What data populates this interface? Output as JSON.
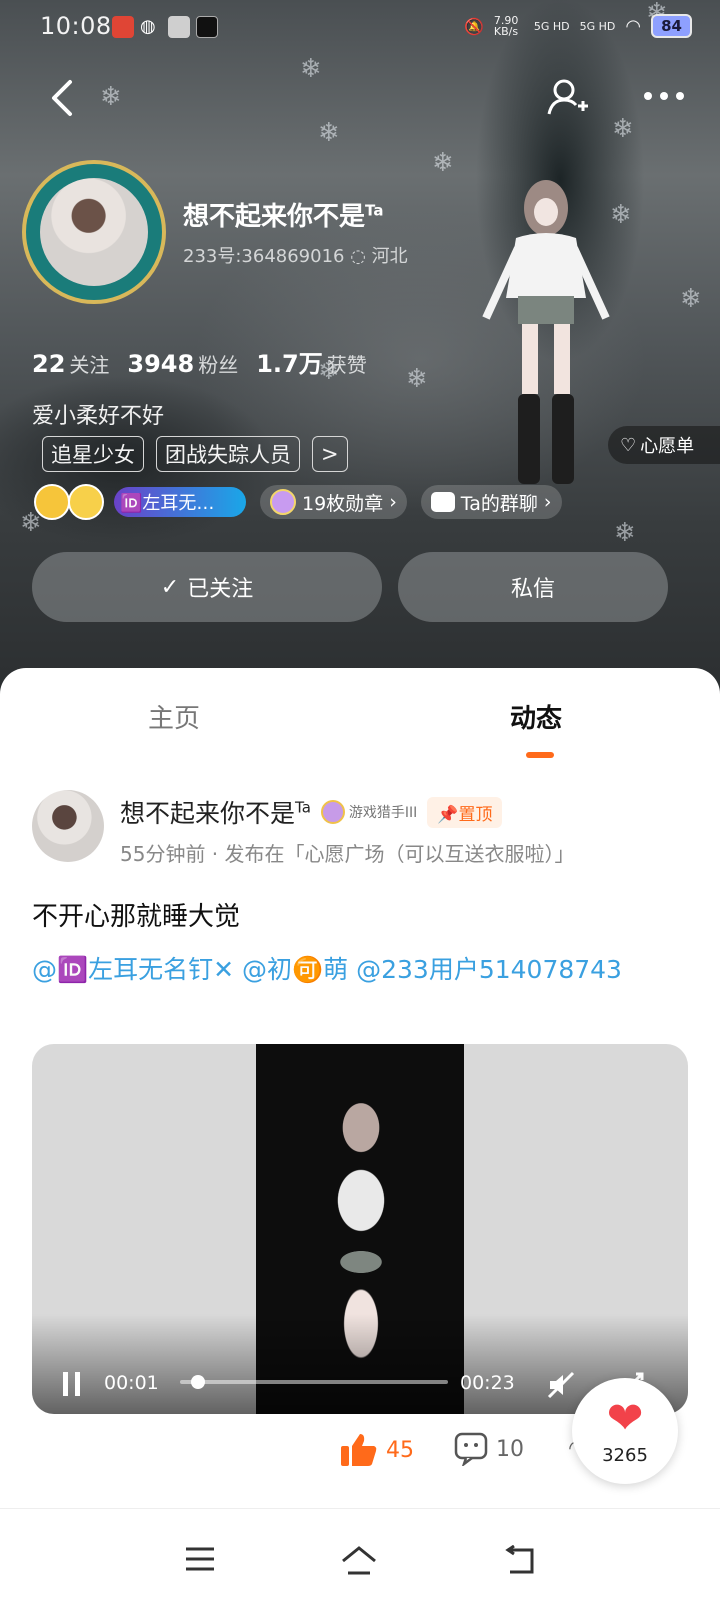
{
  "status_bar": {
    "time": "10:08",
    "net_speed": "7.90 KB/s",
    "signal1": "5G HD",
    "signal2": "5G HD",
    "battery": "84"
  },
  "profile": {
    "nickname": "想不起来你不是",
    "nickname_sup": "Ta",
    "uid": "233号:364869016",
    "location": "河北",
    "stats": {
      "follow_count": "22",
      "follow_label": "关注",
      "fans_count": "3948",
      "fans_label": "粉丝",
      "likes_count": "1.7万",
      "likes_label": "获赞"
    },
    "signature": "爱小柔好不好",
    "tags": [
      "追星少女",
      "团战失踪人员"
    ],
    "tag_more": ">",
    "wishlist_label": "心愿单",
    "fan_badge": "🆔左耳无…",
    "medals_label": "19枚勋章",
    "group_label": "Ta的群聊",
    "followed_label": "已关注",
    "message_label": "私信"
  },
  "tabs": {
    "home": "主页",
    "feed": "动态"
  },
  "post": {
    "author": "想不起来你不是",
    "author_sup": "Ta",
    "level": "游戏猎手III",
    "pinned": "置顶",
    "meta": "55分钟前 · 发布在「心愿广场（可以互送衣服啦）」",
    "title": "不开心那就睡大觉",
    "mentions": "@🆔左耳无名钉✕  @初🉑萌  @233用户514078743",
    "video": {
      "current": "00:01",
      "total": "00:23",
      "progress": 0.04
    },
    "likes": "45",
    "comments": "10",
    "share_label": "享"
  },
  "heart_count": "3265",
  "icons": [
    "back-icon",
    "add-friend-icon",
    "more-icon",
    "heart-outline-icon",
    "check-icon",
    "pause-icon",
    "mute-icon",
    "fullscreen-icon",
    "thumb-up-icon",
    "comment-icon",
    "menu-icon",
    "home-icon",
    "back-nav-icon"
  ],
  "colors": {
    "accent": "#ff6a1a",
    "link": "#3aa0e0",
    "heart": "#f2424a"
  }
}
